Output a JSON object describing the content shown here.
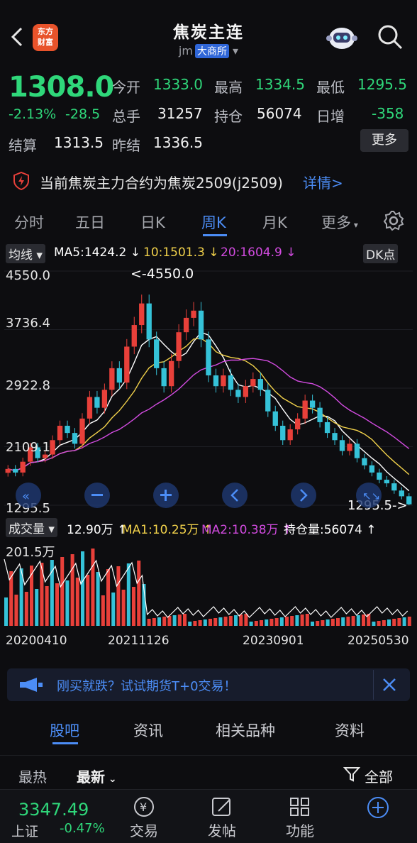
{
  "header": {
    "title": "焦炭主连",
    "code": "jm",
    "exchange": "大商所",
    "logo_text": "东方财富"
  },
  "quote": {
    "price": "1308.0",
    "change_pct": "-2.13%",
    "change": "-28.5",
    "fields": [
      {
        "label": "今开",
        "value": "1333.0"
      },
      {
        "label": "最高",
        "value": "1334.5"
      },
      {
        "label": "最低",
        "value": "1295.5"
      },
      {
        "label": "总手",
        "value": "31257"
      },
      {
        "label": "持仓",
        "value": "56074"
      },
      {
        "label": "日增",
        "value": "-358"
      },
      {
        "label": "结算",
        "value": "1313.5"
      },
      {
        "label": "昨结",
        "value": "1336.5"
      }
    ],
    "more_label": "更多"
  },
  "notice": {
    "text": "当前焦炭主力合约为焦炭2509(j2509)",
    "link": "详情>"
  },
  "tabs": [
    "分时",
    "五日",
    "日K",
    "周K",
    "月K",
    "更多"
  ],
  "active_tab": "周K",
  "ma": {
    "type": "均线",
    "ma5": "MA5:1424.2 ↓",
    "ma10": "10:1501.3 ↓",
    "ma20": "20:1604.9 ↓",
    "dk": "DK点"
  },
  "chart_data": {
    "type": "candlestick",
    "y_ticks": [
      "4550.0",
      "3736.4",
      "2922.8",
      "2109.1",
      "1295.5"
    ],
    "ylim": [
      1295.5,
      4550.0
    ],
    "max_label": "<-4550.0",
    "min_label": "1295.5->",
    "colors": {
      "up": "#e8403a",
      "down": "#35c2d8",
      "ma5": "#ffffff",
      "ma10": "#f2d24b",
      "ma20": "#d24be0"
    },
    "close": [
      1800,
      1750,
      1900,
      2100,
      1950,
      2000,
      2200,
      2400,
      2300,
      2150,
      2500,
      2800,
      2650,
      2900,
      3200,
      3000,
      3500,
      3800,
      4100,
      3600,
      3200,
      2950,
      3300,
      3700,
      3900,
      4000,
      3600,
      3100,
      2950,
      3100,
      2900,
      2800,
      2950,
      3050,
      2900,
      2600,
      2400,
      2200,
      2350,
      2500,
      2750,
      2650,
      2450,
      2300,
      2200,
      2050,
      2150,
      1950,
      1850,
      1750,
      1650,
      1600,
      1500,
      1420,
      1308
    ]
  },
  "volume": {
    "label": "成交量",
    "value": "12.90万 ↑",
    "ma1": "MA1:10.25万 ↑",
    "ma2": "MA2:10.38万 ↑",
    "oi": "持仓量:56074 ↑",
    "y_label": "201.5万"
  },
  "dates": [
    "20200410",
    "20211126",
    "20230901",
    "20250530"
  ],
  "promo": {
    "text": "刚买就跌？试试期货T+0交易！"
  },
  "subtabs": [
    "股吧",
    "资讯",
    "相关品种",
    "资料"
  ],
  "sort": {
    "hot": "最热",
    "new": "最新",
    "filter": "全部"
  },
  "index": {
    "value": "3347.49",
    "name": "上证",
    "pct": "-0.47%"
  },
  "nav": [
    "交易",
    "发帖",
    "功能"
  ]
}
